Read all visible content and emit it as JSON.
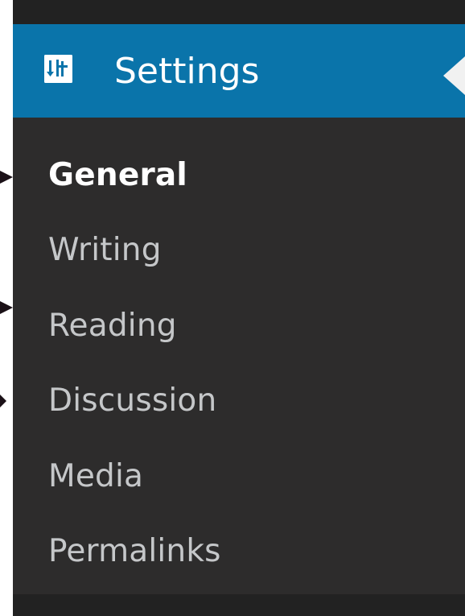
{
  "settings_menu": {
    "title": "Settings",
    "icon": "settings-sliders-icon",
    "active_item": "General",
    "items": [
      {
        "label": "General"
      },
      {
        "label": "Writing"
      },
      {
        "label": "Reading"
      },
      {
        "label": "Discussion"
      },
      {
        "label": "Media"
      },
      {
        "label": "Permalinks"
      }
    ]
  },
  "colors": {
    "menu_background": "#2d2c2c",
    "header_background": "#0a74aa",
    "active_text": "#ffffff",
    "inactive_text": "#c5c7c9",
    "annotation_arrow": "#1b1117"
  }
}
